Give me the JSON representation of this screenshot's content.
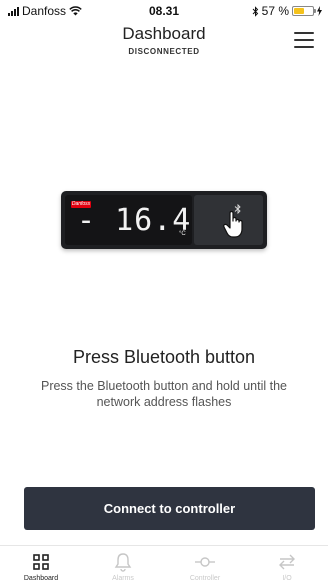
{
  "status_bar": {
    "carrier": "Danfoss",
    "time": "08.31",
    "battery_text": "57 %",
    "battery_level": 0.57
  },
  "header": {
    "title": "Dashboard",
    "subtitle": "DISCONNECTED"
  },
  "device": {
    "brand": "Danfoss",
    "reading": "- 16.4",
    "unit": "°C"
  },
  "instructions": {
    "heading": "Press Bluetooth button",
    "description": "Press the Bluetooth button and hold until the network address flashes"
  },
  "connect_button": {
    "label": "Connect to controller"
  },
  "tabs": [
    {
      "label": "Dashboard",
      "icon": "grid-icon",
      "active": true
    },
    {
      "label": "Alarms",
      "icon": "bell-icon",
      "active": false
    },
    {
      "label": "Controller",
      "icon": "controller-icon",
      "active": false
    },
    {
      "label": "I/O",
      "icon": "arrows-icon",
      "active": false
    }
  ],
  "colors": {
    "button_bg": "#2f3440",
    "battery": "#f4c21c",
    "brand_red": "#e2000f"
  }
}
